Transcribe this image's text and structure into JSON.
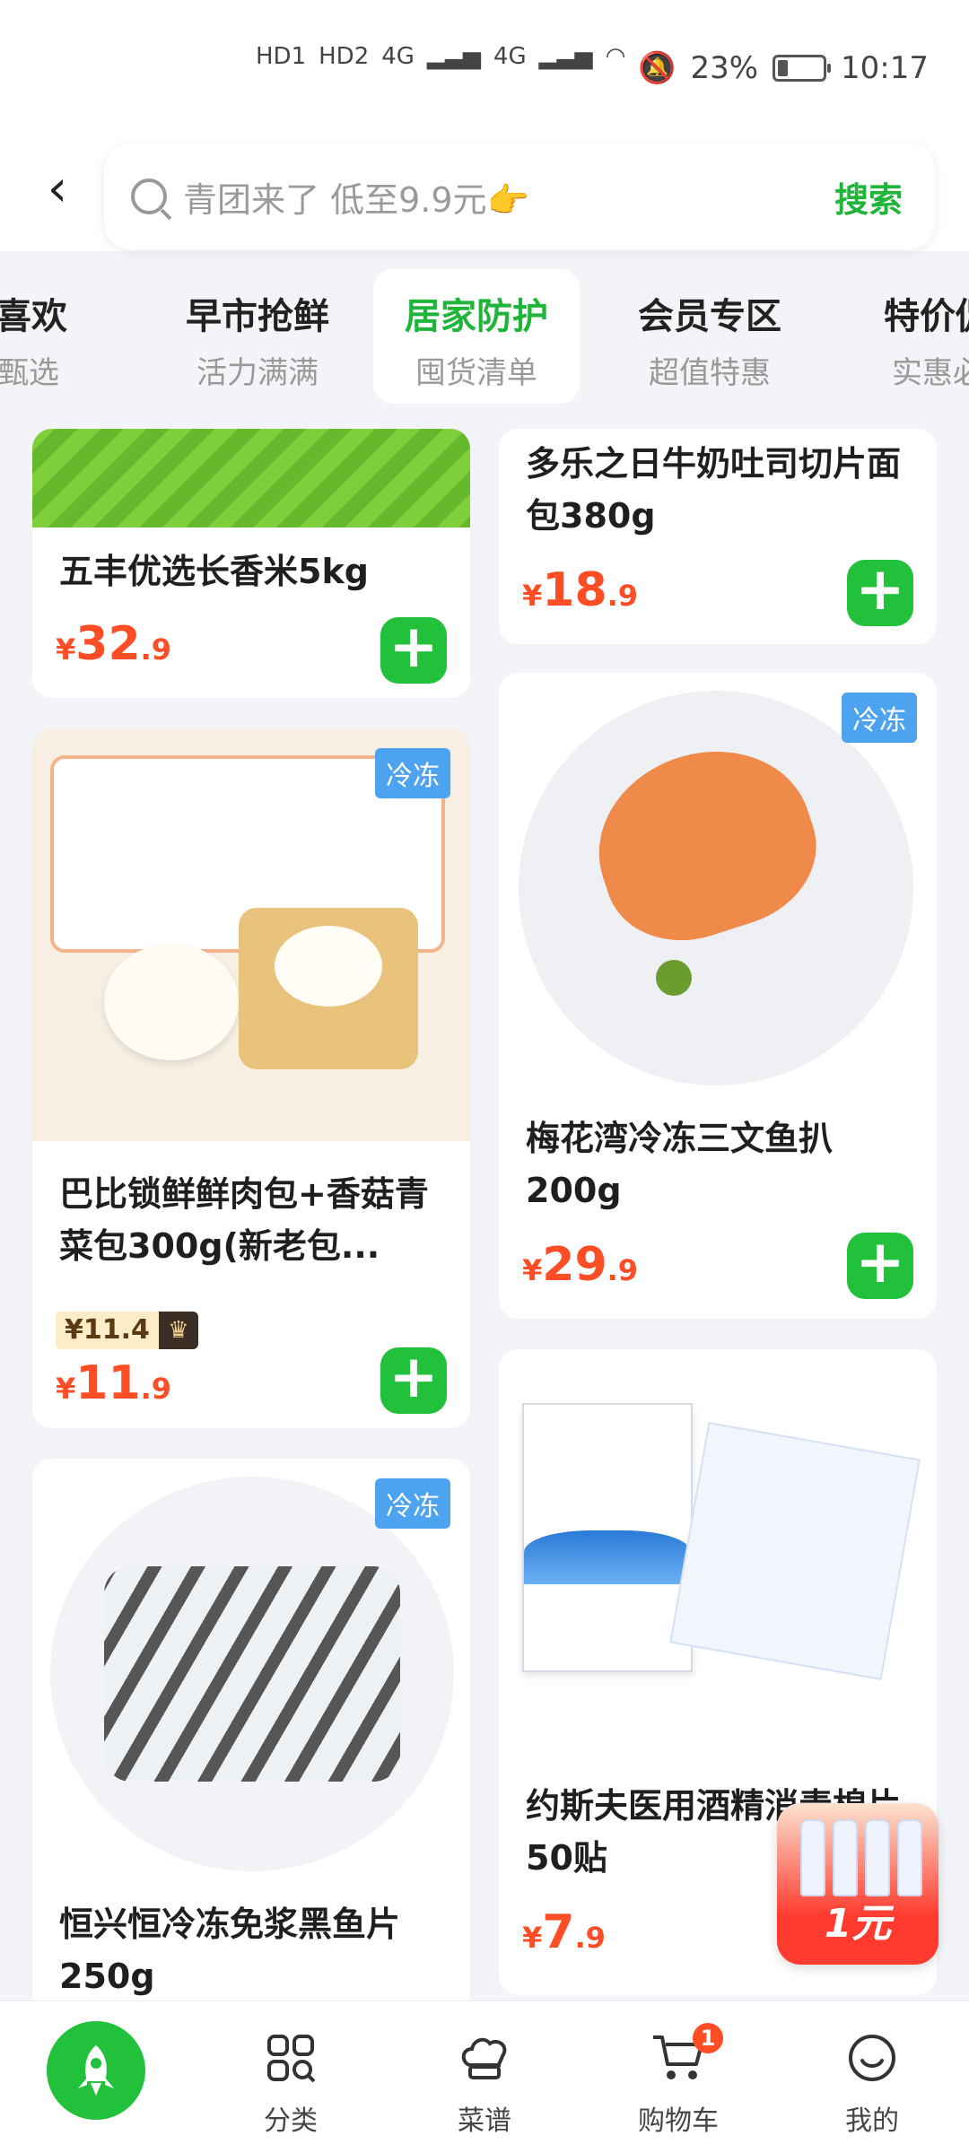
{
  "status_bar": {
    "network_hd1": "HD1",
    "network_hd2": "HD2",
    "net1": "4G",
    "net2": "4G",
    "battery": "23%",
    "time": "10:17"
  },
  "header": {
    "search_placeholder": "青团来了 低至9.9元👉",
    "search_button": "搜索"
  },
  "tabs": [
    {
      "title": "你喜欢",
      "subtitle": "气甄选"
    },
    {
      "title": "早市抢鲜",
      "subtitle": "活力满满"
    },
    {
      "title": "居家防护",
      "subtitle": "囤货清单"
    },
    {
      "title": "会员专区",
      "subtitle": "超值特惠"
    },
    {
      "title": "特价促",
      "subtitle": "实惠必"
    }
  ],
  "products": [
    {
      "name": "五丰优选长香米5kg",
      "price_main": "32",
      "price_dec": ".9",
      "currency": "¥"
    },
    {
      "name": "多乐之日牛奶吐司切片面包380g",
      "price_main": "18",
      "price_dec": ".9",
      "currency": "¥"
    },
    {
      "name": "巴比锁鲜鲜肉包+香菇青菜包300g(新老包...",
      "badge": "冷冻",
      "vip_price": "¥11.4",
      "price_main": "11",
      "price_dec": ".9",
      "currency": "¥"
    },
    {
      "name": "梅花湾冷冻三文鱼扒200g",
      "badge": "冷冻",
      "price_main": "29",
      "price_dec": ".9",
      "currency": "¥"
    },
    {
      "name": "恒兴恒冷冻免浆黑鱼片250g",
      "badge": "冷冻"
    },
    {
      "name": "约斯夫医用酒精消毒棉片50贴",
      "price_main": "7",
      "price_dec": ".9",
      "currency": "¥"
    }
  ],
  "coupon": {
    "text": "1元"
  },
  "bottom_nav": [
    {
      "label": "分类"
    },
    {
      "label": "菜谱"
    },
    {
      "label": "购物车",
      "badge": "1"
    },
    {
      "label": "我的"
    }
  ],
  "colors": {
    "accent": "#22c13b",
    "price": "#ff4d26",
    "frozen_badge": "#4da3f0"
  }
}
